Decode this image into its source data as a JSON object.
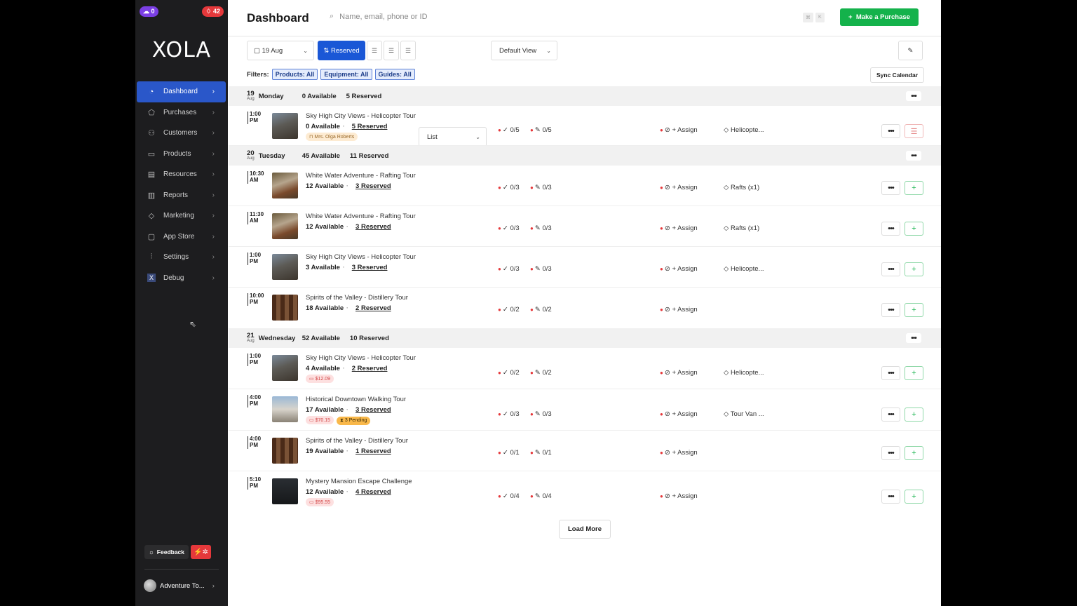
{
  "sidebar": {
    "badge_left": "0",
    "badge_right": "42",
    "logo": "XOLA",
    "items": [
      {
        "label": "Dashboard",
        "icon": "gauge-icon"
      },
      {
        "label": "Purchases",
        "icon": "tag-icon"
      },
      {
        "label": "Customers",
        "icon": "users-icon"
      },
      {
        "label": "Products",
        "icon": "box-icon"
      },
      {
        "label": "Resources",
        "icon": "clipboard-icon"
      },
      {
        "label": "Reports",
        "icon": "bar-chart-icon"
      },
      {
        "label": "Marketing",
        "icon": "megaphone-icon"
      },
      {
        "label": "App Store",
        "icon": "square-icon"
      },
      {
        "label": "Settings",
        "icon": "sliders-icon"
      },
      {
        "label": "Debug",
        "icon": "x-icon"
      }
    ],
    "feedback": "Feedback",
    "account": "Adventure To..."
  },
  "header": {
    "title": "Dashboard",
    "search_placeholder": "Name, email, phone or ID",
    "kbd1": "⌘",
    "kbd2": "K",
    "purchase_label": "Make a Purchase"
  },
  "toolbar": {
    "date": "19 Aug",
    "reserved": "Reserved",
    "view_mode": "List",
    "view": "Default View"
  },
  "filters": {
    "label": "Filters:",
    "products": "Products: All",
    "equipment": "Equipment: All",
    "guides": "Guides: All",
    "sync": "Sync Calendar"
  },
  "days": [
    {
      "num": "19",
      "month": "Aug",
      "name": "Monday",
      "available": "0 Available",
      "reserved": "5 Reserved"
    },
    {
      "num": "20",
      "month": "Aug",
      "name": "Tuesday",
      "available": "45 Available",
      "reserved": "11 Reserved"
    },
    {
      "num": "21",
      "month": "Aug",
      "name": "Wednesday",
      "available": "52 Available",
      "reserved": "10 Reserved"
    }
  ],
  "events": [
    {
      "time1": "1:00",
      "time2": "PM",
      "title": "Sky High City Views - Helicopter Tour",
      "available": "0 Available",
      "reserved": "5 Reserved",
      "owner": "Mrs. Olga Roberts",
      "checkin": "0/5",
      "waiver": "0/5",
      "assign": "+ Assign",
      "equip": "Helicopte..."
    },
    {
      "time1": "10:30",
      "time2": "AM",
      "title": "White Water Adventure - Rafting Tour",
      "available": "12 Available",
      "reserved": "3 Reserved",
      "checkin": "0/3",
      "waiver": "0/3",
      "assign": "+ Assign",
      "equip": "Rafts (x1)"
    },
    {
      "time1": "11:30",
      "time2": "AM",
      "title": "White Water Adventure - Rafting Tour",
      "available": "12 Available",
      "reserved": "3 Reserved",
      "checkin": "0/3",
      "waiver": "0/3",
      "assign": "+ Assign",
      "equip": "Rafts (x1)"
    },
    {
      "time1": "1:00",
      "time2": "PM",
      "title": "Sky High City Views - Helicopter Tour",
      "available": "3 Available",
      "reserved": "3 Reserved",
      "checkin": "0/3",
      "waiver": "0/3",
      "assign": "+ Assign",
      "equip": "Helicopte..."
    },
    {
      "time1": "10:00",
      "time2": "PM",
      "title": "Spirits of the Valley - Distillery Tour",
      "available": "18 Available",
      "reserved": "2 Reserved",
      "checkin": "0/2",
      "waiver": "0/2",
      "assign": "+ Assign"
    },
    {
      "time1": "1:00",
      "time2": "PM",
      "title": "Sky High City Views - Helicopter Tour",
      "available": "4 Available",
      "reserved": "2 Reserved",
      "price": "$12.09",
      "checkin": "0/2",
      "waiver": "0/2",
      "assign": "+ Assign",
      "equip": "Helicopte..."
    },
    {
      "time1": "4:00",
      "time2": "PM",
      "title": "Historical Downtown Walking Tour",
      "available": "17 Available",
      "reserved": "3 Reserved",
      "price": "$70.15",
      "pending": "3 Pending",
      "checkin": "0/3",
      "waiver": "0/3",
      "assign": "+ Assign",
      "equip": "Tour Van ..."
    },
    {
      "time1": "4:00",
      "time2": "PM",
      "title": "Spirits of the Valley - Distillery Tour",
      "available": "19 Available",
      "reserved": "1 Reserved",
      "checkin": "0/1",
      "waiver": "0/1",
      "assign": "+ Assign"
    },
    {
      "time1": "5:10",
      "time2": "PM",
      "title": "Mystery Mansion Escape Challenge",
      "available": "12 Available",
      "reserved": "4 Reserved",
      "price": "$95.55",
      "checkin": "0/4",
      "waiver": "0/4",
      "assign": "+ Assign"
    }
  ],
  "load_more": "Load More",
  "colors": {
    "accent": "#1a57d6",
    "primary_action": "#14b24b",
    "sidebar": "#1d1d1f",
    "alert": "#e5383b"
  }
}
